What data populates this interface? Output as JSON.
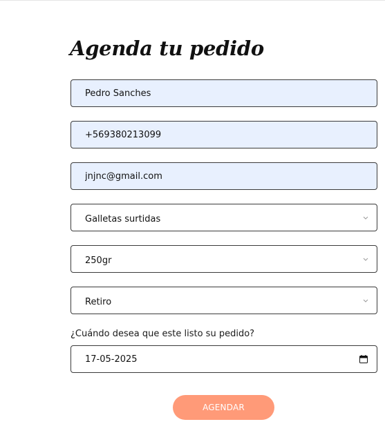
{
  "form": {
    "title": "Agenda tu pedido",
    "name_value": "Pedro Sanches",
    "phone_value": "+569380213099",
    "email_value": "jnjnc@gmail.com",
    "product_value": "Galletas surtidas",
    "size_value": "250gr",
    "delivery_value": "Retiro",
    "date_label": "¿Cuándo desea que este listo su pedido?",
    "date_value": "17-05-2025",
    "submit_label": "AGENDAR"
  },
  "colors": {
    "autofill_background": "#e8f0fe",
    "border": "#3a3a3a",
    "button_background": "#ff9a78",
    "button_text": "#ffffff"
  },
  "icons": {
    "select_arrow": "chevron-down-icon",
    "date_picker": "calendar-icon"
  }
}
